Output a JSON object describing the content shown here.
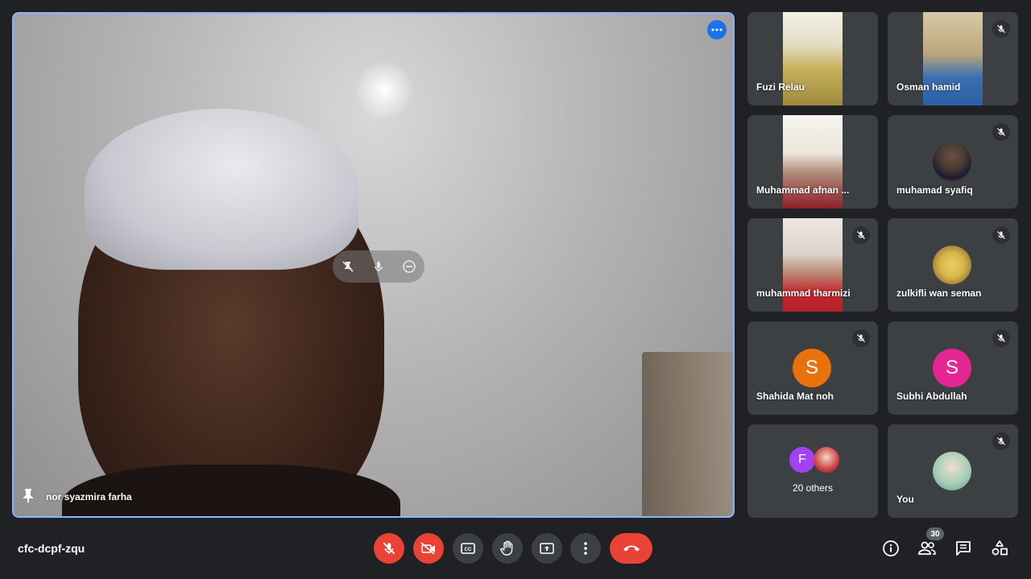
{
  "main_video": {
    "speaker_name": "nor syazmira farha"
  },
  "participants": [
    {
      "name": "Fuzi Relau",
      "muted": false,
      "type": "video",
      "colors": [
        "#cdb66a",
        "#9e8a3e"
      ]
    },
    {
      "name": "Osman hamid",
      "muted": true,
      "type": "video",
      "colors": [
        "#d8c9a6",
        "#2a6fbf"
      ]
    },
    {
      "name": "Muhammad afnan ...",
      "muted": false,
      "type": "video",
      "colors": [
        "#f1efe9",
        "#8f1f2a"
      ]
    },
    {
      "name": "muhamad syafiq",
      "muted": true,
      "type": "avatar-photo",
      "colors": [
        "#4a3b33",
        "#b3232c"
      ]
    },
    {
      "name": "muhammad tharmizi",
      "muted": true,
      "type": "video",
      "colors": [
        "#e8e2dc",
        "#c6262e"
      ]
    },
    {
      "name": "zulkifli wan seman",
      "muted": true,
      "type": "avatar-photo",
      "colors": [
        "#d8b64a",
        "#6f4e2b"
      ]
    },
    {
      "name": "Shahida Mat noh",
      "muted": true,
      "type": "avatar-letter",
      "letter": "S",
      "colors": [
        "#e8710a"
      ]
    },
    {
      "name": "Subhi Abdullah",
      "muted": true,
      "type": "avatar-letter",
      "letter": "S",
      "colors": [
        "#e52592"
      ]
    }
  ],
  "others": {
    "label": "20 others",
    "avatar_letter": "F",
    "avatar_color": "#a142f4"
  },
  "self_tile": {
    "name": "You",
    "muted": true
  },
  "meeting": {
    "code": "cfc-dcpf-zqu",
    "participant_count": "30"
  },
  "toolbar": {
    "mic": "mic-off-icon",
    "camera": "camera-off-icon",
    "captions": "captions-icon",
    "raise_hand": "raise-hand-icon",
    "present": "present-screen-icon",
    "more": "more-options-icon",
    "end_call": "end-call-icon"
  },
  "right_controls": [
    "info-icon",
    "people-icon",
    "chat-icon",
    "activities-icon"
  ],
  "colors": {
    "background": "#202124",
    "tile": "#3c4043",
    "accent_blue": "#8ab4f8",
    "danger_red": "#ea4335"
  }
}
